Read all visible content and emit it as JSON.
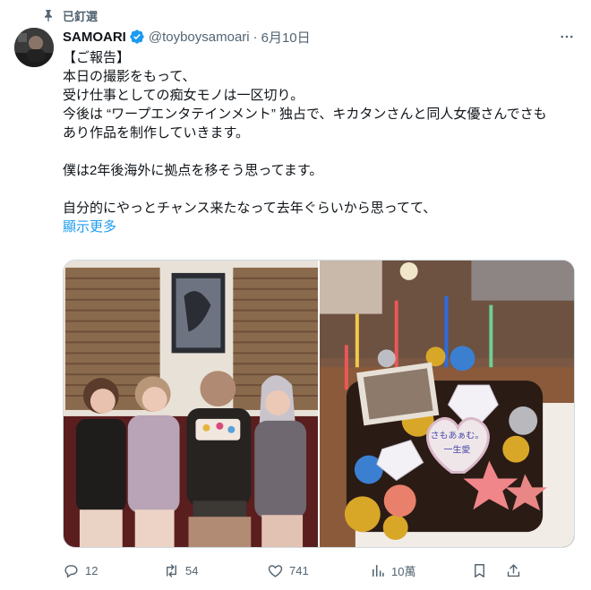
{
  "pinned": {
    "label": "已釘選"
  },
  "author": {
    "name": "SAMOARI",
    "handle": "@toyboysamoari",
    "separator": "·",
    "date": "6月10日"
  },
  "post": {
    "lines": [
      "【ご報告】",
      "本日の撮影をもって、",
      "受け仕事としての痴女モノは一区切り。",
      "今後は “ワープエンタテインメント” 独占で、キカタンさんと同人女優さんでさも",
      "あり作品を制作していきます。",
      "",
      "僕は2年後海外に拠点を移そう思ってます。",
      "",
      "自分的にやっとチャンス来たなって去年ぐらいから思ってて、"
    ],
    "show_more": "顯示更多"
  },
  "media": {
    "cake_plaque_text": [
      "さもあぁむ。",
      "一生愛"
    ]
  },
  "actions": {
    "replies": "12",
    "reposts": "54",
    "likes": "741",
    "views": "10萬"
  },
  "colors": {
    "accent": "#1d9bf0",
    "secondary_text": "#536471",
    "border": "#cfd9de",
    "verified": "#1d9bf0"
  },
  "icons": [
    "pin-icon",
    "verified-badge-icon",
    "more-icon",
    "reply-icon",
    "repost-icon",
    "like-icon",
    "views-icon",
    "bookmark-icon",
    "share-icon"
  ]
}
